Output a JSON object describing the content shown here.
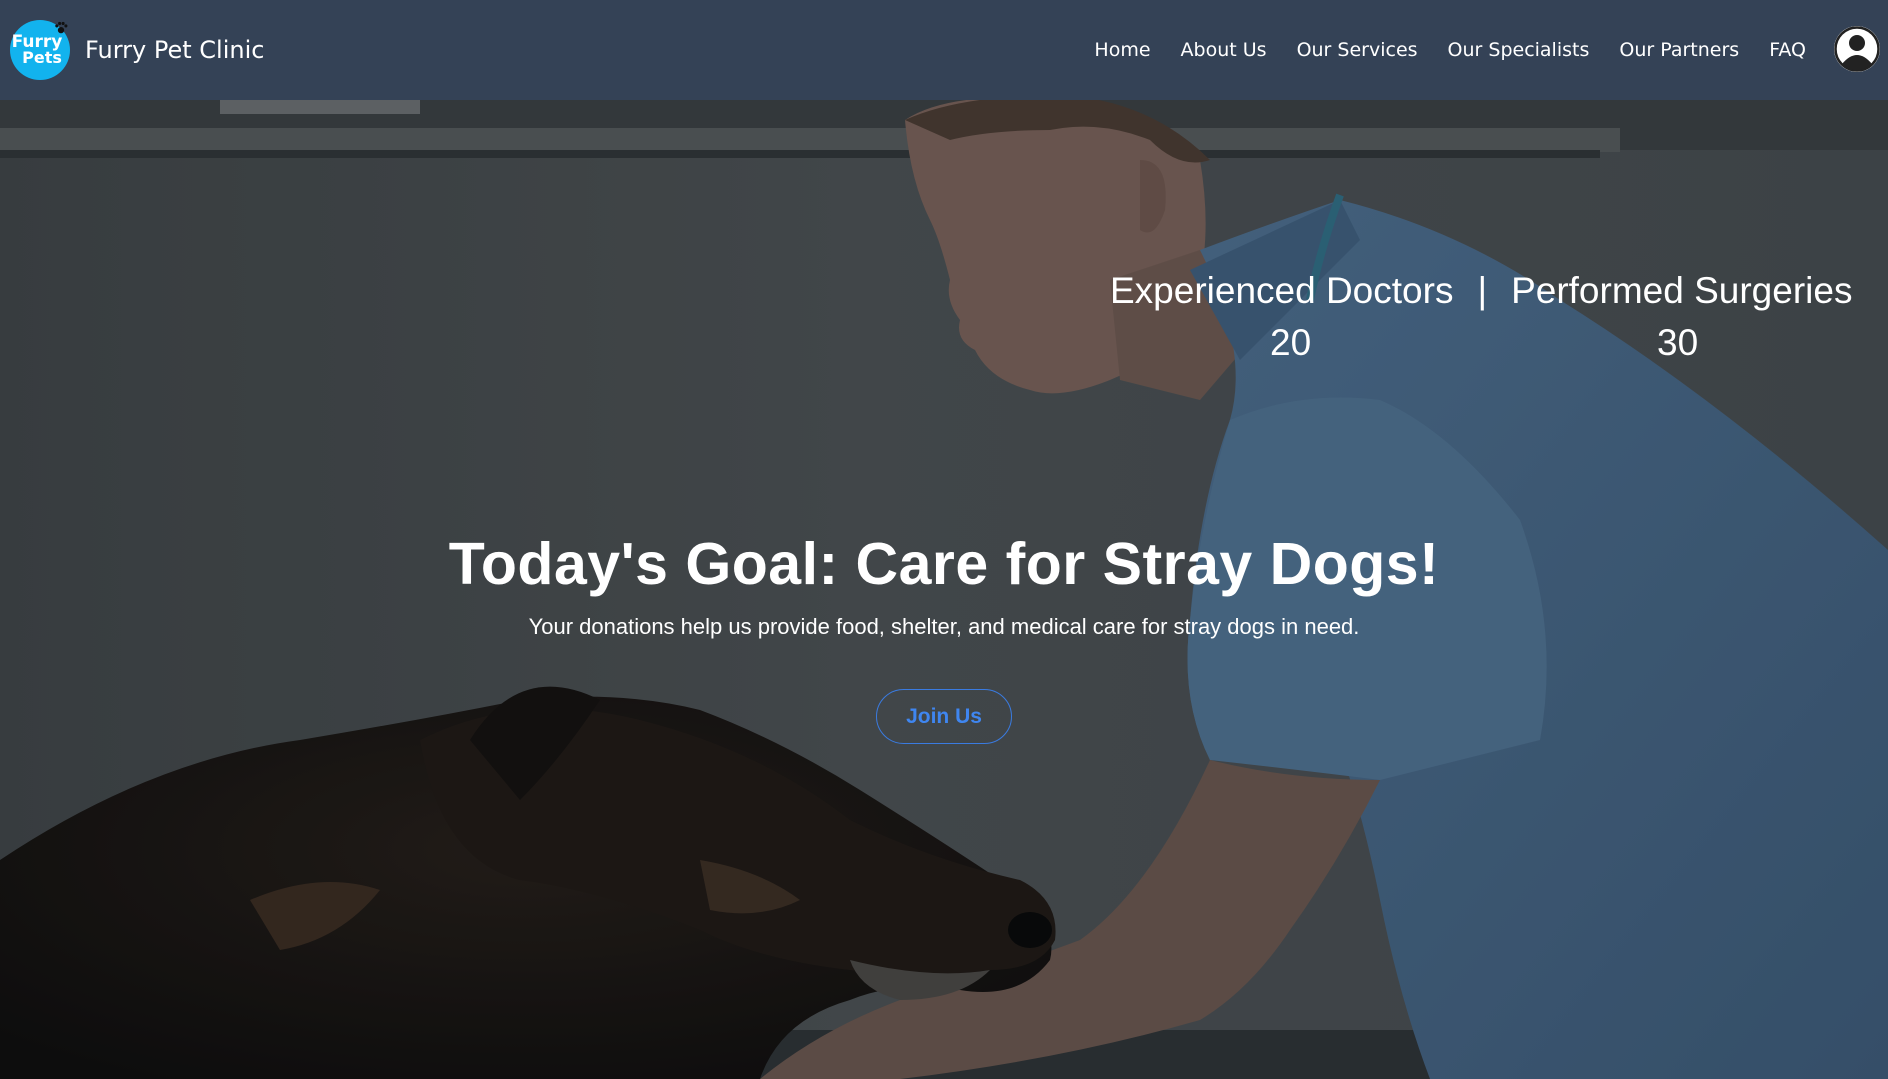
{
  "header": {
    "logo": {
      "line1": "Furry",
      "line2": "Pets",
      "icon": "paw-print-icon"
    },
    "brand_name": "Furry Pet Clinic",
    "nav": [
      {
        "label": "Home"
      },
      {
        "label": "About Us"
      },
      {
        "label": "Our Services"
      },
      {
        "label": "Our Specialists"
      },
      {
        "label": "Our Partners"
      },
      {
        "label": "FAQ"
      }
    ],
    "avatar_icon": "user-avatar-icon"
  },
  "hero": {
    "stats": {
      "label1": "Experienced Doctors",
      "separator": "|",
      "label2": "Performed Surgeries",
      "value1": "20",
      "value2": "30"
    },
    "headline": "Today's Goal: Care for Stray Dogs!",
    "subtext": "Your donations help us provide food, shelter, and medical care for stray dogs in need.",
    "cta_label": "Join Us"
  },
  "colors": {
    "navbar": "#344256",
    "logo": "#12b3ee",
    "cta": "#3f86f0",
    "scrubs": "#4a6b8c"
  }
}
